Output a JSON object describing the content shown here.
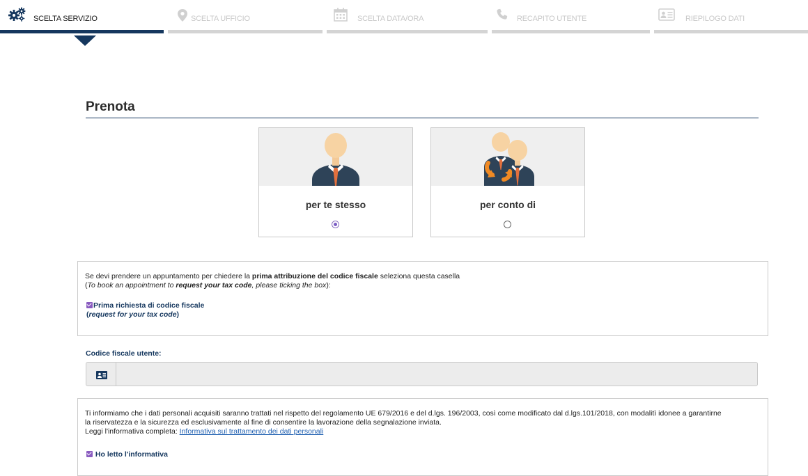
{
  "steps": [
    {
      "label": "SCELTA SERVIZIO",
      "icon": "gears-icon",
      "active": true
    },
    {
      "label": "SCELTA UFFICIO",
      "icon": "map-pin-icon",
      "active": false
    },
    {
      "label": "SCELTA DATA/ORA",
      "icon": "calendar-icon",
      "active": false
    },
    {
      "label": "RECAPITO UTENTE",
      "icon": "phone-icon",
      "active": false
    },
    {
      "label": "RIEPILOGO DATI",
      "icon": "id-card-icon",
      "active": false
    }
  ],
  "title": "Prenota",
  "options": [
    {
      "label": "per te stesso",
      "selected": true,
      "icon": "single-person-icon"
    },
    {
      "label": "per conto di",
      "selected": false,
      "icon": "two-persons-exchange-icon"
    }
  ],
  "tax_info": {
    "line1_pre": "Se devi prendere un appuntamento per chiedere la ",
    "line1_bold": "prima attribuzione del codice fiscale",
    "line1_post": " seleziona questa casella",
    "line2_open": "(",
    "line2_pre": "To book an appointment to ",
    "line2_bold": "request your tax code",
    "line2_post": ", please ticking the box",
    "line2_close": "):",
    "checkbox_label": "Prima richiesta di codice fiscale",
    "checkbox_sub_open": "(",
    "checkbox_sub": "request for your tax code",
    "checkbox_sub_close": ")",
    "checked": true
  },
  "codice_fiscale": {
    "label": "Codice fiscale utente:",
    "value": "",
    "icon": "id-card-icon"
  },
  "privacy": {
    "text1": "Ti informiamo che i dati personali acquisiti saranno trattati nel rispetto del regolamento UE 679/2016 e del d.lgs. 196/2003, così come modificato dal d.lgs.101/2018, con modalitì idonee a garantirne",
    "text2": "la riservatezza e la sicurezza ed esclusivamente al fine di consentire la lavorazione della segnalazione inviata.",
    "text3": "Leggi l'informativa completa: ",
    "link": "Informativa sul trattamento dei dati personali",
    "checkbox_label": "Ho letto l'informativa",
    "checked": true
  },
  "colors": {
    "navy": "#15375e",
    "checkbox": "#8a5cc0",
    "link": "#1f5fb0"
  }
}
